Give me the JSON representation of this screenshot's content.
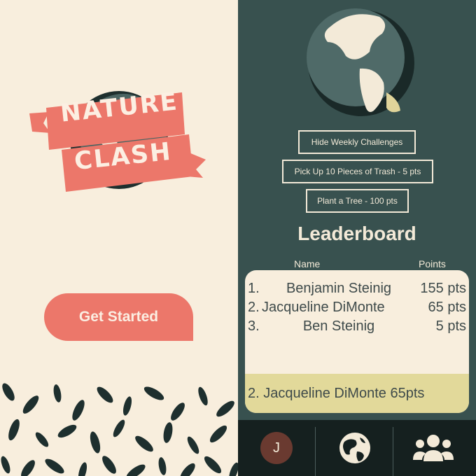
{
  "app": {
    "logo_word1": "NATURE",
    "logo_word2": "CLASH",
    "get_started_label": "Get Started"
  },
  "challenges": {
    "toggle_label": "Hide Weekly Challenges",
    "items": [
      {
        "label": "Pick Up 10 Pieces of Trash - 5 pts"
      },
      {
        "label": "Plant a Tree - 100 pts"
      }
    ]
  },
  "leaderboard": {
    "title": "Leaderboard",
    "col_name": "Name",
    "col_points": "Points",
    "rows": [
      {
        "rank": "1.",
        "name": "Benjamin Steinig",
        "points": "155 pts"
      },
      {
        "rank": "2.",
        "name": "Jacqueline DiMonte",
        "points": "65 pts"
      },
      {
        "rank": "3.",
        "name": "Ben Steinig",
        "points": "5 pts"
      }
    ],
    "current_user": "2. Jacqueline DiMonte 65pts"
  },
  "nav": {
    "avatar_initial": "J",
    "items": [
      {
        "icon": "profile-avatar"
      },
      {
        "icon": "globe-icon"
      },
      {
        "icon": "people-icon"
      }
    ]
  },
  "colors": {
    "cream": "#f8eedd",
    "teal": "#38514f",
    "coral": "#ec776a",
    "nav_dark": "#15201f",
    "highlight": "#e2d99a"
  }
}
